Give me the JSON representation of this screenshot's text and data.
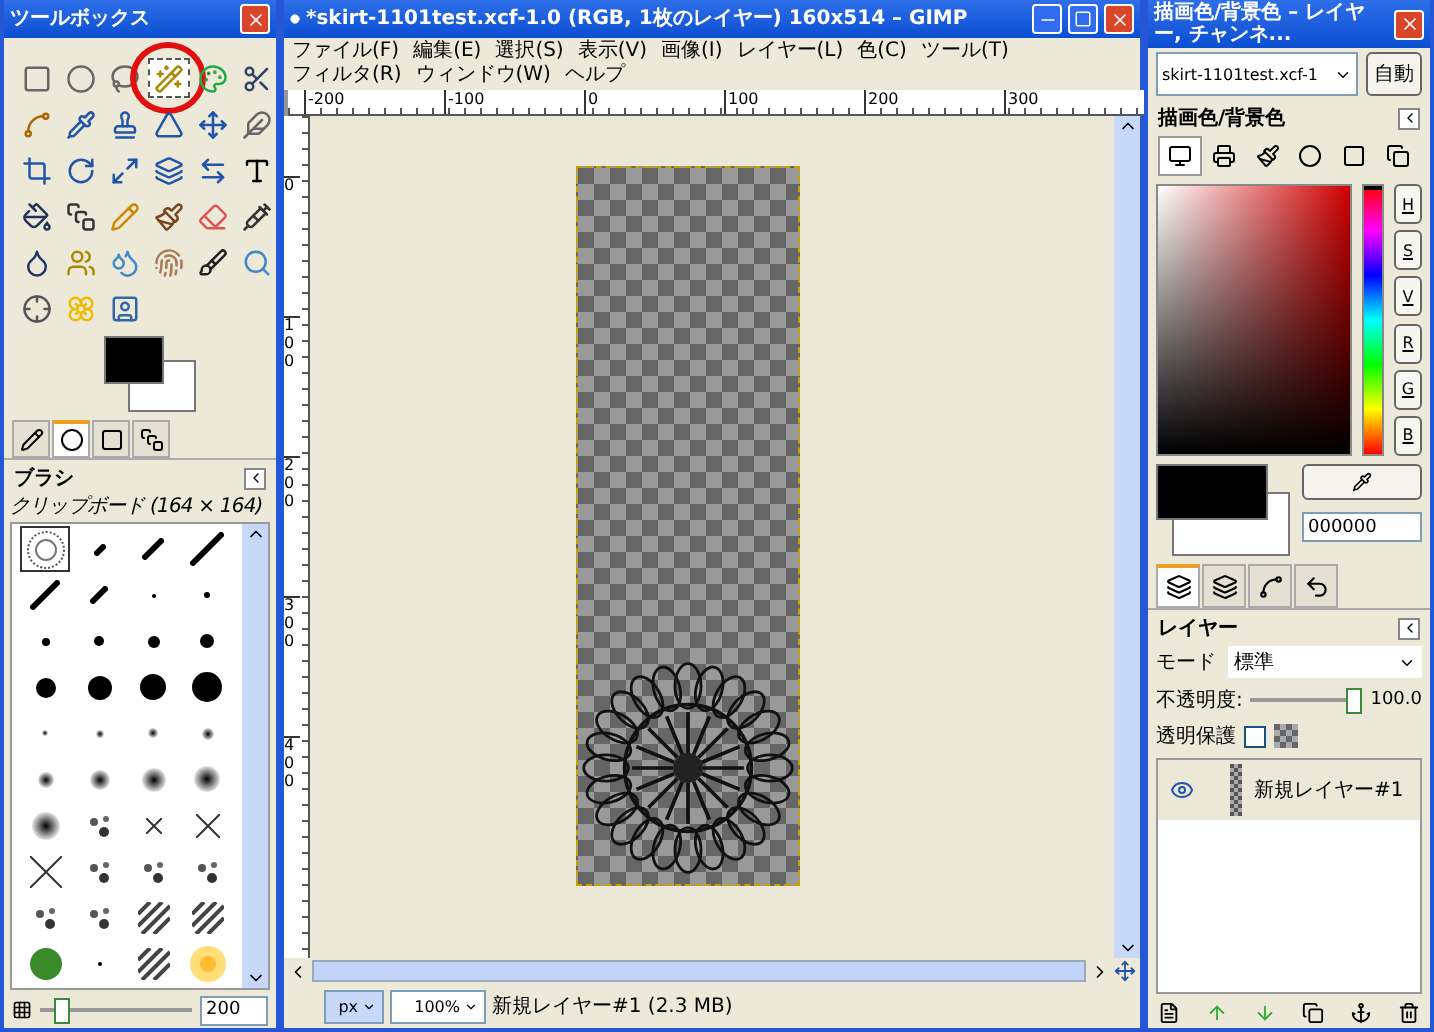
{
  "toolbox": {
    "title": "ツールボックス",
    "tools": [
      {
        "selected": false,
        "circled": false
      },
      {
        "selected": false,
        "circled": false
      },
      {
        "selected": false,
        "circled": false
      },
      {
        "selected": true,
        "circled": true
      },
      {
        "selected": false,
        "circled": false
      },
      {
        "selected": false,
        "circled": false
      },
      {
        "selected": false,
        "circled": false
      },
      {
        "selected": false,
        "circled": false
      },
      {
        "selected": false,
        "circled": false
      },
      {
        "selected": false,
        "circled": false
      },
      {
        "selected": false,
        "circled": false
      },
      {
        "selected": false,
        "circled": false
      },
      {
        "selected": false,
        "circled": false
      },
      {
        "selected": false,
        "circled": false
      },
      {
        "selected": false,
        "circled": false
      },
      {
        "selected": false,
        "circled": false
      },
      {
        "selected": false,
        "circled": false
      },
      {
        "selected": false,
        "circled": false
      },
      {
        "selected": false,
        "circled": false
      },
      {
        "selected": false,
        "circled": false
      },
      {
        "selected": false,
        "circled": false
      },
      {
        "selected": false,
        "circled": false
      },
      {
        "selected": false,
        "circled": false
      },
      {
        "selected": false,
        "circled": false
      },
      {
        "selected": false,
        "circled": false
      },
      {
        "selected": false,
        "circled": false
      },
      {
        "selected": false,
        "circled": false
      },
      {
        "selected": false,
        "circled": false
      },
      {
        "selected": false,
        "circled": false
      },
      {
        "selected": false,
        "circled": false
      },
      {
        "selected": false,
        "circled": false
      },
      {
        "selected": false,
        "circled": false
      },
      {
        "selected": false,
        "circled": false
      }
    ],
    "tabs": [
      {
        "selected": false
      },
      {
        "selected": true
      },
      {
        "selected": false
      },
      {
        "selected": false
      }
    ],
    "brushes_panel": {
      "title": "ブラシ",
      "subtitle": "クリップボード (164 × 164)",
      "size_slider": {
        "level": 0.1
      },
      "size_value": "200",
      "brushes": [
        {
          "selected": true
        },
        {
          "selected": false
        },
        {
          "selected": false
        },
        {
          "selected": false
        },
        {
          "selected": false
        },
        {
          "selected": false
        },
        {
          "selected": false
        },
        {
          "selected": false
        },
        {
          "selected": false
        },
        {
          "selected": false
        },
        {
          "selected": false
        },
        {
          "selected": false
        },
        {
          "selected": false
        },
        {
          "selected": false
        },
        {
          "selected": false
        },
        {
          "selected": false
        },
        {
          "selected": false
        },
        {
          "selected": false
        },
        {
          "selected": false
        },
        {
          "selected": false
        },
        {
          "selected": false
        },
        {
          "selected": false
        },
        {
          "selected": false
        },
        {
          "selected": false
        },
        {
          "selected": false
        },
        {
          "selected": false
        },
        {
          "selected": false
        },
        {
          "selected": false
        },
        {
          "selected": false
        },
        {
          "selected": false
        },
        {
          "selected": false
        },
        {
          "selected": false
        },
        {
          "selected": false
        },
        {
          "selected": false
        },
        {
          "selected": false
        },
        {
          "selected": false
        },
        {
          "selected": false
        },
        {
          "selected": false
        },
        {
          "selected": false
        },
        {
          "selected": false
        }
      ]
    }
  },
  "image_window": {
    "title": "*skirt-1101test.xcf-1.0 (RGB, 1枚のレイヤー) 160x514 – GIMP",
    "menu": [
      "ファイル(F)",
      "編集(E)",
      "選択(S)",
      "表示(V)",
      "画像(I)",
      "レイヤー(L)",
      "色(C)",
      "ツール(T)",
      "フィルタ(R)",
      "ウィンドウ(W)",
      "ヘルプ"
    ],
    "ruler_labels": [
      "-200",
      "-100",
      "0",
      "100",
      "200",
      "300"
    ],
    "vertical_ruler_labels": [
      "0",
      "100",
      "200",
      "300",
      "400"
    ],
    "status_bar": {
      "unit": "px",
      "zoom": "100%",
      "message": "新規レイヤー#1 (2.3 MB)"
    }
  },
  "dock": {
    "title": "描画色/背景色 – レイヤー, チャンネ...",
    "image_select": "skirt-1101test.xcf-1",
    "auto_button": "自動",
    "color_panel": {
      "title": "描画色/背景色",
      "hue": {
        "level": 1.0
      },
      "channels": [
        "H",
        "S",
        "V",
        "R",
        "G",
        "B"
      ],
      "hex_value": "000000"
    },
    "tabs": [
      {
        "selected": true
      },
      {
        "selected": false
      },
      {
        "selected": false
      },
      {
        "selected": false
      }
    ],
    "layers_panel": {
      "title": "レイヤー",
      "mode_label": "モード",
      "mode_value": "標準",
      "opacity_label": "不透明度:",
      "opacity": {
        "level": 1.0,
        "reading": "100.0"
      },
      "lock_label": "透明保護",
      "lock_alpha": false,
      "layers": [
        {
          "name": "新規レイヤー#1",
          "visible": true,
          "selected": true
        }
      ]
    }
  }
}
